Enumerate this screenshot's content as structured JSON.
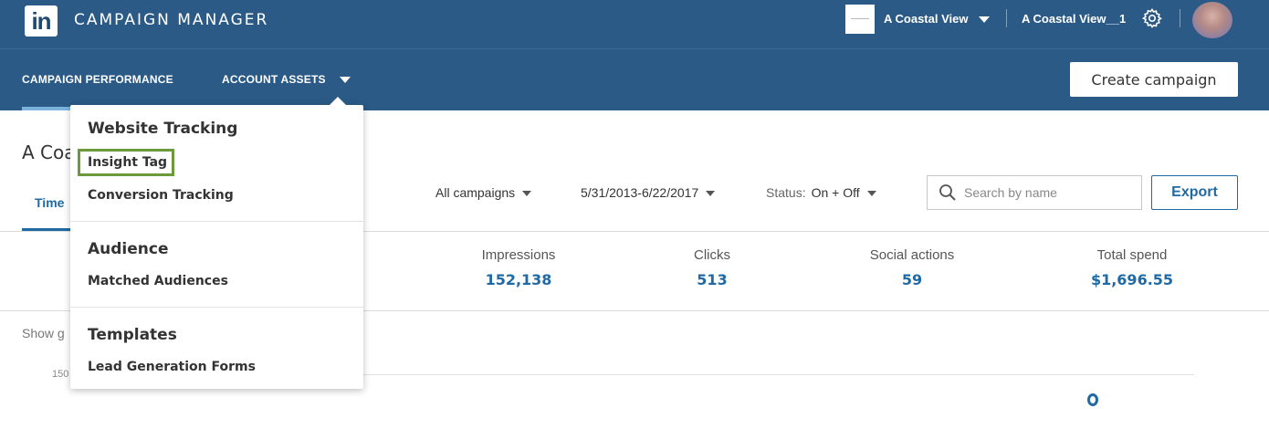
{
  "header": {
    "logo_text": "in",
    "app_title": "CAMPAIGN MANAGER",
    "account_name": "A Coastal View",
    "account_id": "A Coastal View__1"
  },
  "nav": {
    "campaign_performance": "CAMPAIGN PERFORMANCE",
    "account_assets": "ACCOUNT ASSETS",
    "create_campaign": "Create campaign"
  },
  "dropdown": {
    "sections": [
      {
        "heading": "Website Tracking",
        "items": [
          "Insight Tag",
          "Conversion Tracking"
        ]
      },
      {
        "heading": "Audience",
        "items": [
          "Matched Audiences"
        ]
      },
      {
        "heading": "Templates",
        "items": [
          "Lead Generation Forms"
        ]
      }
    ]
  },
  "page": {
    "title": "A Coa",
    "tab_time": "Time",
    "show_graph": "Show g",
    "y_tick": "150"
  },
  "filters": {
    "campaigns": "All campaigns",
    "date_range": "5/31/2013-6/22/2017",
    "status_label": "Status:",
    "status_value": "On + Off",
    "search_placeholder": "Search by name",
    "export": "Export"
  },
  "metrics": [
    {
      "label": "Impressions",
      "value": "152,138"
    },
    {
      "label": "Clicks",
      "value": "513"
    },
    {
      "label": "Social actions",
      "value": "59"
    },
    {
      "label": "Total spend",
      "value": "$1,696.55"
    }
  ],
  "colors": {
    "header_bg": "#2a5a85",
    "link_blue": "#1f6aa5",
    "highlight_green": "#6a9a3c"
  }
}
